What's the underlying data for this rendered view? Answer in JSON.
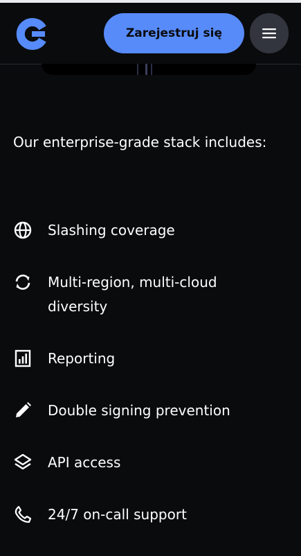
{
  "header": {
    "logo_name": "c-logo-icon",
    "signup_label": "Zarejestruj się",
    "menu_icon": "hamburger-menu-icon"
  },
  "content": {
    "intro": "Our enterprise-grade stack includes:",
    "features": [
      {
        "label": "Slashing coverage",
        "icon": "globe-icon"
      },
      {
        "label": "Multi-region, multi-cloud diversity",
        "icon": "sync-icon"
      },
      {
        "label": "Reporting",
        "icon": "bar-chart-icon"
      },
      {
        "label": "Double signing prevention",
        "icon": "pencil-icon"
      },
      {
        "label": "API access",
        "icon": "layers-icon"
      },
      {
        "label": "24/7 on-call support",
        "icon": "phone-icon"
      }
    ]
  },
  "colors": {
    "background": "#0a0b0d",
    "accent": "#578bfa",
    "menu_button": "#32353d",
    "text": "#ffffff"
  }
}
